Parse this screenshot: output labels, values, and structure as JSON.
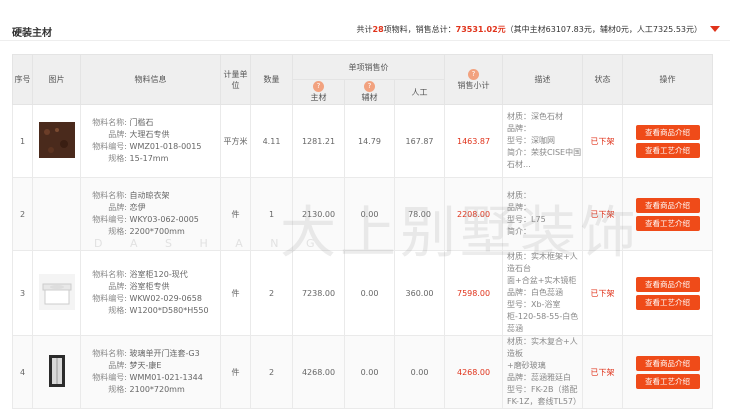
{
  "header": {
    "title": "硬装主材",
    "summary_prefix": "共计",
    "item_count": "28",
    "summary_mid": "项物料，销售总计：",
    "total": "73531.02元",
    "breakdown": "（其中主材63107.83元，辅材0元，人工7325.53元）"
  },
  "columns": {
    "seq": "序号",
    "image": "图片",
    "info": "物料信息",
    "unit": "计量单位",
    "qty": "数量",
    "unit_price": "单项销售价",
    "main": "主材",
    "aux": "辅材",
    "labor": "人工",
    "subtotal": "销售小计",
    "desc": "描述",
    "status": "状态",
    "action": "操作",
    "help": "?"
  },
  "labels": {
    "name": "物料名称:",
    "brand": "品牌:",
    "code": "物料编号:",
    "spec": "规格:",
    "material": "材质:",
    "model": "型号:",
    "intro": "简介:",
    "btn_goods": "查看商品介绍",
    "btn_process": "查看工艺介绍"
  },
  "rows": [
    {
      "seq": "1",
      "name": "门槛石",
      "brand": "大理石专供",
      "code": "WMZ01-018-0015",
      "spec": "15-17mm",
      "unit": "平方米",
      "qty": "4.11",
      "main": "1281.21",
      "aux": "14.79",
      "labor": "167.87",
      "subtotal": "1463.87",
      "d1": "材质：深色石材",
      "d2": "品牌：",
      "d3": "型号：深咖网",
      "d4": "简介：荣获CISE中国石材...",
      "status": "已下架"
    },
    {
      "seq": "2",
      "name": "自动晾衣架",
      "brand": "恋伊",
      "code": "WKY03-062-0005",
      "spec": "2200*700mm",
      "unit": "件",
      "qty": "1",
      "main": "2130.00",
      "aux": "0.00",
      "labor": "78.00",
      "subtotal": "2208.00",
      "d1": "材质：",
      "d2": "品牌：",
      "d3": "型号：L75",
      "d4": "简介：",
      "status": "已下架"
    },
    {
      "seq": "3",
      "name": "浴室柜120-现代",
      "brand": "浴室柜专供",
      "code": "WKW02-029-0658",
      "spec": "W1200*D580*H550",
      "unit": "件",
      "qty": "2",
      "main": "7238.00",
      "aux": "0.00",
      "labor": "360.00",
      "subtotal": "7598.00",
      "d1": "材质：实木框架+人造石台",
      "d2": "面+合盆+实木镜柜",
      "d3": "品牌：白色蕊涵",
      "d4": "型号：Xb-浴室柜-120-58-55-白色蕊涵",
      "status": "已下架"
    },
    {
      "seq": "4",
      "name": "玻璃单开门连套-G3",
      "brand": "梦天-康E",
      "code": "WMM01-021-1344",
      "spec": "2100*720mm",
      "unit": "件",
      "qty": "2",
      "main": "4268.00",
      "aux": "0.00",
      "labor": "0.00",
      "subtotal": "4268.00",
      "d1": "材质：实木复合+人造板",
      "d2": "+磨砂玻璃",
      "d3": "品牌：蕊涵雅廷白",
      "d4": "型号：FK-2B（搭配FK-1Z，套线TL57）",
      "status": "已下架"
    }
  ],
  "watermark": {
    "main": "大上别墅装饰",
    "sub": "D A S H A N G"
  },
  "colors": {
    "accent": "#ef4b19",
    "price": "#e0331b"
  }
}
